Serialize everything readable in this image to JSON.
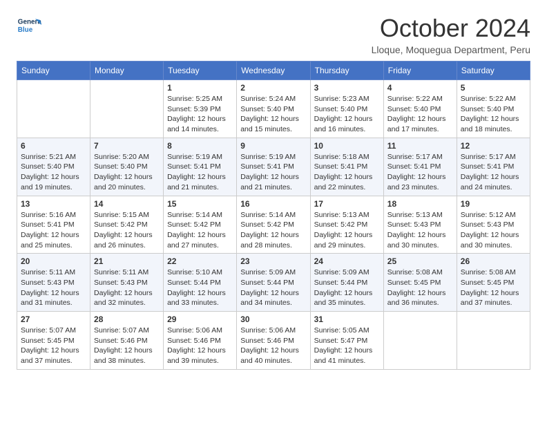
{
  "header": {
    "logo_general": "General",
    "logo_blue": "Blue",
    "month_title": "October 2024",
    "subtitle": "Lloque, Moquegua Department, Peru"
  },
  "weekdays": [
    "Sunday",
    "Monday",
    "Tuesday",
    "Wednesday",
    "Thursday",
    "Friday",
    "Saturday"
  ],
  "weeks": [
    [
      {
        "day": "",
        "sunrise": "",
        "sunset": "",
        "daylight": ""
      },
      {
        "day": "",
        "sunrise": "",
        "sunset": "",
        "daylight": ""
      },
      {
        "day": "1",
        "sunrise": "Sunrise: 5:25 AM",
        "sunset": "Sunset: 5:39 PM",
        "daylight": "Daylight: 12 hours and 14 minutes."
      },
      {
        "day": "2",
        "sunrise": "Sunrise: 5:24 AM",
        "sunset": "Sunset: 5:40 PM",
        "daylight": "Daylight: 12 hours and 15 minutes."
      },
      {
        "day": "3",
        "sunrise": "Sunrise: 5:23 AM",
        "sunset": "Sunset: 5:40 PM",
        "daylight": "Daylight: 12 hours and 16 minutes."
      },
      {
        "day": "4",
        "sunrise": "Sunrise: 5:22 AM",
        "sunset": "Sunset: 5:40 PM",
        "daylight": "Daylight: 12 hours and 17 minutes."
      },
      {
        "day": "5",
        "sunrise": "Sunrise: 5:22 AM",
        "sunset": "Sunset: 5:40 PM",
        "daylight": "Daylight: 12 hours and 18 minutes."
      }
    ],
    [
      {
        "day": "6",
        "sunrise": "Sunrise: 5:21 AM",
        "sunset": "Sunset: 5:40 PM",
        "daylight": "Daylight: 12 hours and 19 minutes."
      },
      {
        "day": "7",
        "sunrise": "Sunrise: 5:20 AM",
        "sunset": "Sunset: 5:40 PM",
        "daylight": "Daylight: 12 hours and 20 minutes."
      },
      {
        "day": "8",
        "sunrise": "Sunrise: 5:19 AM",
        "sunset": "Sunset: 5:41 PM",
        "daylight": "Daylight: 12 hours and 21 minutes."
      },
      {
        "day": "9",
        "sunrise": "Sunrise: 5:19 AM",
        "sunset": "Sunset: 5:41 PM",
        "daylight": "Daylight: 12 hours and 21 minutes."
      },
      {
        "day": "10",
        "sunrise": "Sunrise: 5:18 AM",
        "sunset": "Sunset: 5:41 PM",
        "daylight": "Daylight: 12 hours and 22 minutes."
      },
      {
        "day": "11",
        "sunrise": "Sunrise: 5:17 AM",
        "sunset": "Sunset: 5:41 PM",
        "daylight": "Daylight: 12 hours and 23 minutes."
      },
      {
        "day": "12",
        "sunrise": "Sunrise: 5:17 AM",
        "sunset": "Sunset: 5:41 PM",
        "daylight": "Daylight: 12 hours and 24 minutes."
      }
    ],
    [
      {
        "day": "13",
        "sunrise": "Sunrise: 5:16 AM",
        "sunset": "Sunset: 5:41 PM",
        "daylight": "Daylight: 12 hours and 25 minutes."
      },
      {
        "day": "14",
        "sunrise": "Sunrise: 5:15 AM",
        "sunset": "Sunset: 5:42 PM",
        "daylight": "Daylight: 12 hours and 26 minutes."
      },
      {
        "day": "15",
        "sunrise": "Sunrise: 5:14 AM",
        "sunset": "Sunset: 5:42 PM",
        "daylight": "Daylight: 12 hours and 27 minutes."
      },
      {
        "day": "16",
        "sunrise": "Sunrise: 5:14 AM",
        "sunset": "Sunset: 5:42 PM",
        "daylight": "Daylight: 12 hours and 28 minutes."
      },
      {
        "day": "17",
        "sunrise": "Sunrise: 5:13 AM",
        "sunset": "Sunset: 5:42 PM",
        "daylight": "Daylight: 12 hours and 29 minutes."
      },
      {
        "day": "18",
        "sunrise": "Sunrise: 5:13 AM",
        "sunset": "Sunset: 5:43 PM",
        "daylight": "Daylight: 12 hours and 30 minutes."
      },
      {
        "day": "19",
        "sunrise": "Sunrise: 5:12 AM",
        "sunset": "Sunset: 5:43 PM",
        "daylight": "Daylight: 12 hours and 30 minutes."
      }
    ],
    [
      {
        "day": "20",
        "sunrise": "Sunrise: 5:11 AM",
        "sunset": "Sunset: 5:43 PM",
        "daylight": "Daylight: 12 hours and 31 minutes."
      },
      {
        "day": "21",
        "sunrise": "Sunrise: 5:11 AM",
        "sunset": "Sunset: 5:43 PM",
        "daylight": "Daylight: 12 hours and 32 minutes."
      },
      {
        "day": "22",
        "sunrise": "Sunrise: 5:10 AM",
        "sunset": "Sunset: 5:44 PM",
        "daylight": "Daylight: 12 hours and 33 minutes."
      },
      {
        "day": "23",
        "sunrise": "Sunrise: 5:09 AM",
        "sunset": "Sunset: 5:44 PM",
        "daylight": "Daylight: 12 hours and 34 minutes."
      },
      {
        "day": "24",
        "sunrise": "Sunrise: 5:09 AM",
        "sunset": "Sunset: 5:44 PM",
        "daylight": "Daylight: 12 hours and 35 minutes."
      },
      {
        "day": "25",
        "sunrise": "Sunrise: 5:08 AM",
        "sunset": "Sunset: 5:45 PM",
        "daylight": "Daylight: 12 hours and 36 minutes."
      },
      {
        "day": "26",
        "sunrise": "Sunrise: 5:08 AM",
        "sunset": "Sunset: 5:45 PM",
        "daylight": "Daylight: 12 hours and 37 minutes."
      }
    ],
    [
      {
        "day": "27",
        "sunrise": "Sunrise: 5:07 AM",
        "sunset": "Sunset: 5:45 PM",
        "daylight": "Daylight: 12 hours and 37 minutes."
      },
      {
        "day": "28",
        "sunrise": "Sunrise: 5:07 AM",
        "sunset": "Sunset: 5:46 PM",
        "daylight": "Daylight: 12 hours and 38 minutes."
      },
      {
        "day": "29",
        "sunrise": "Sunrise: 5:06 AM",
        "sunset": "Sunset: 5:46 PM",
        "daylight": "Daylight: 12 hours and 39 minutes."
      },
      {
        "day": "30",
        "sunrise": "Sunrise: 5:06 AM",
        "sunset": "Sunset: 5:46 PM",
        "daylight": "Daylight: 12 hours and 40 minutes."
      },
      {
        "day": "31",
        "sunrise": "Sunrise: 5:05 AM",
        "sunset": "Sunset: 5:47 PM",
        "daylight": "Daylight: 12 hours and 41 minutes."
      },
      {
        "day": "",
        "sunrise": "",
        "sunset": "",
        "daylight": ""
      },
      {
        "day": "",
        "sunrise": "",
        "sunset": "",
        "daylight": ""
      }
    ]
  ]
}
